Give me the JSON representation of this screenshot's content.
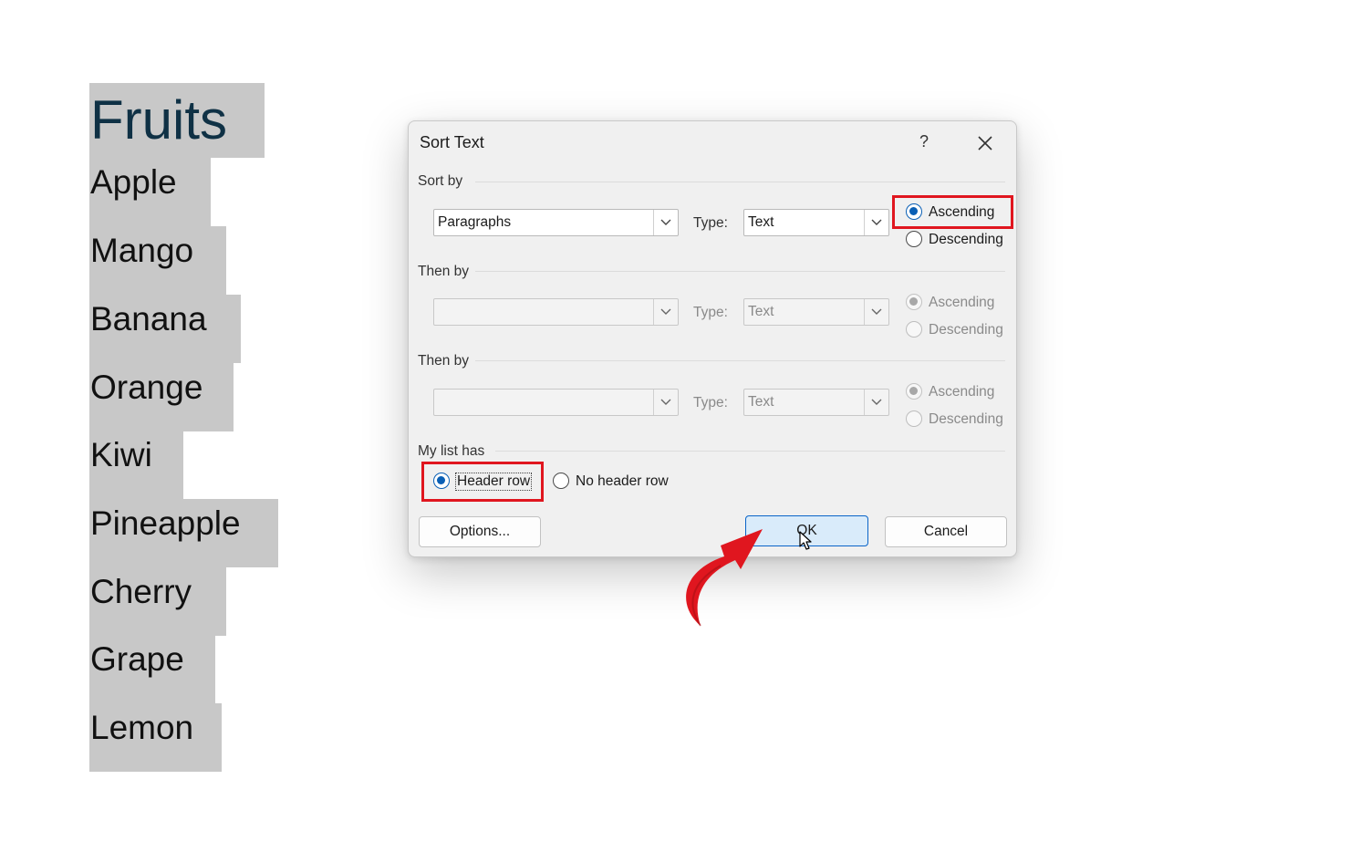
{
  "document": {
    "heading": "Fruits",
    "items": [
      "Apple",
      "Mango",
      "Banana",
      "Orange",
      "Kiwi",
      "Pineapple",
      "Cherry",
      "Grape",
      "Lemon"
    ]
  },
  "dialog": {
    "title": "Sort Text",
    "help": "?",
    "sort_by": {
      "label": "Sort by",
      "field": "Paragraphs",
      "type_label": "Type:",
      "type_value": "Text",
      "ascending": "Ascending",
      "descending": "Descending",
      "selected": "ascending"
    },
    "then_by_1": {
      "label": "Then by",
      "field": "",
      "type_label": "Type:",
      "type_value": "Text",
      "ascending": "Ascending",
      "descending": "Descending"
    },
    "then_by_2": {
      "label": "Then by",
      "field": "",
      "type_label": "Type:",
      "type_value": "Text",
      "ascending": "Ascending",
      "descending": "Descending"
    },
    "list_has": {
      "label": "My list has",
      "header_row": "Header row",
      "no_header_row": "No header row",
      "selected": "header_row"
    },
    "buttons": {
      "options": "Options...",
      "ok": "OK",
      "cancel": "Cancel"
    }
  },
  "colors": {
    "highlight": "#e0161f",
    "accent": "#0a5fb5",
    "doc_heading": "#0f3145",
    "doc_highlight": "#c8c8c8"
  }
}
